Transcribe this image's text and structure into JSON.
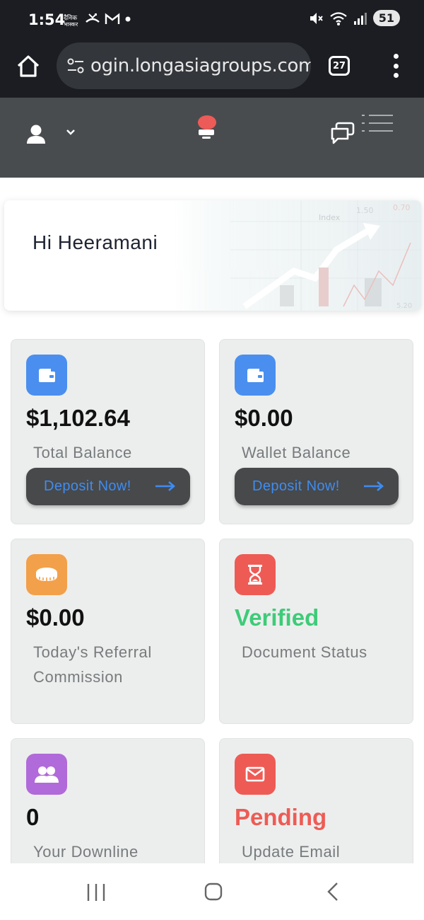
{
  "status_bar": {
    "time": "1:54",
    "notification_icons": [
      "news-icon",
      "missed-call-icon",
      "gmail-icon",
      "dot-icon"
    ],
    "battery": "51"
  },
  "browser": {
    "url": "ogin.longasiagroups.com",
    "tab_count": "27"
  },
  "greeting": {
    "text": "Hi Heeramani",
    "art_labels": [
      "Index",
      "1.50",
      "0.70",
      "5.20"
    ]
  },
  "cards": [
    {
      "value": "$1,102.64",
      "label": "Total Balance",
      "button": "Deposit Now!",
      "icon": "wallet-icon",
      "icon_color": "#4a8ff0"
    },
    {
      "value": "$0.00",
      "label": "Wallet Balance",
      "button": "Deposit Now!",
      "icon": "wallet-icon",
      "icon_color": "#4a8ff0"
    },
    {
      "value": "$0.00",
      "label": "Today's Referral Commission",
      "icon": "coin-icon",
      "icon_color": "#f3a04a"
    },
    {
      "value": "Verified",
      "label": "Document Status",
      "icon": "hourglass-icon",
      "icon_color": "#ee5b55",
      "value_color": "#3ecb79"
    },
    {
      "value": "0",
      "label": "Your Downline",
      "icon": "users-icon",
      "icon_color": "#b16ad9"
    },
    {
      "value": "Pending",
      "label": "Update Email",
      "icon": "mail-icon",
      "icon_color": "#ee5b55",
      "value_color": "#ee5b55"
    }
  ],
  "colors": {
    "header_bg": "#494c4f",
    "card_bg": "#eceeed",
    "accent_blue": "#3f8cf0"
  }
}
